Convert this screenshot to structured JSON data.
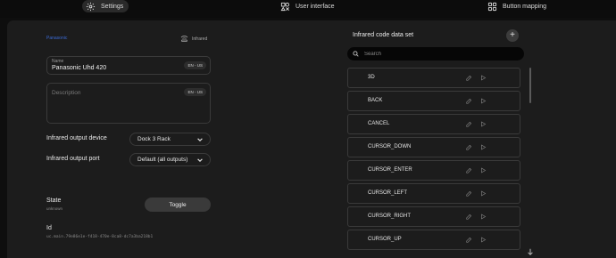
{
  "tabs": [
    {
      "label": "Settings",
      "icon": "gear-icon",
      "active": true
    },
    {
      "label": "User interface",
      "icon": "user-interface-icon",
      "active": false
    },
    {
      "label": "Button mapping",
      "icon": "button-grid-icon",
      "active": false
    }
  ],
  "device": {
    "brand": "Panasonic",
    "type_label": "Infrared"
  },
  "name_field": {
    "label": "Name",
    "value": "Panasonic Uhd 420",
    "lang": "EN - US"
  },
  "description_field": {
    "placeholder": "Description",
    "lang": "EN - US"
  },
  "output_device": {
    "label": "Infrared output device",
    "value": "Dock 3 Rack"
  },
  "output_port": {
    "label": "Infrared output port",
    "value": "Default (all outputs)"
  },
  "state": {
    "label": "State",
    "value": "unknown",
    "button_label": "Toggle"
  },
  "id": {
    "label": "Id",
    "value": "uc.main.79e86e1e-f418-470e-8ca8-dc7a3ba218b1"
  },
  "codes": {
    "title": "Infrared code data set",
    "search_placeholder": "Search",
    "items": [
      "3D",
      "BACK",
      "CANCEL",
      "CURSOR_DOWN",
      "CURSOR_ENTER",
      "CURSOR_LEFT",
      "CURSOR_RIGHT",
      "CURSOR_UP"
    ]
  },
  "colors": {
    "background": "#0e0e0e",
    "panel": "#1c1c1c",
    "brand_accent": "#3b6bd6",
    "border": "#3a3a3a"
  }
}
